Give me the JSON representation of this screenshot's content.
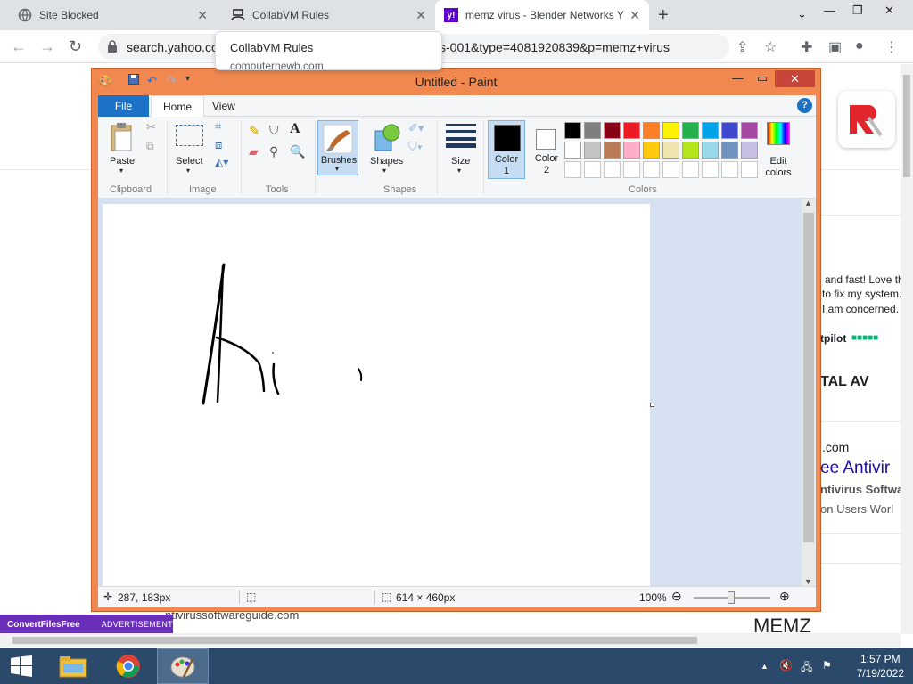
{
  "browser": {
    "tabs": [
      {
        "title": "Site Blocked"
      },
      {
        "title": "CollabVM Rules"
      },
      {
        "title": "memz virus - Blender Networks Y"
      }
    ],
    "new_tab": "+",
    "url_start": "search.yahoo.co",
    "url_end": "s-001&type=4081920839&p=memz+virus",
    "tooltip_title": "CollabVM Rules",
    "tooltip_url": "computernewb.com"
  },
  "background_page": {
    "review_lines": [
      "and fast! Love th",
      "to fix my system.",
      "I am concerned."
    ],
    "trustpilot": "tpilot",
    "brand": "TAL AV",
    "domain_suffix": ".com",
    "ad_title": "ee Antivir",
    "ad_subtitle": "ntivirus Softwa",
    "ad_line": "on Users Worl",
    "left_domain": "ntivirussoftwareguide.com",
    "bottom_right": "MEMZ",
    "ad_brand": "ConvertFilesFree",
    "ad_label": "ADVERTISEMENT"
  },
  "paint": {
    "title": "Untitled - Paint",
    "menu": {
      "file": "File",
      "home": "Home",
      "view": "View",
      "help": "?"
    },
    "groups": {
      "clipboard": "Clipboard",
      "image": "Image",
      "tools": "Tools",
      "shapes": "Shapes",
      "colors": "Colors"
    },
    "buttons": {
      "paste": "Paste",
      "select": "Select",
      "brushes": "Brushes",
      "shapes": "Shapes",
      "size": "Size",
      "color1_a": "Color",
      "color1_b": "1",
      "color2_a": "Color",
      "color2_b": "2",
      "edit_a": "Edit",
      "edit_b": "colors"
    },
    "palette_row1": [
      "#000000",
      "#7f7f7f",
      "#880015",
      "#ed1c24",
      "#ff7f27",
      "#fff200",
      "#22b14c",
      "#00a2e8",
      "#3f48cc",
      "#a349a4"
    ],
    "palette_row2": [
      "#ffffff",
      "#c3c3c3",
      "#b97a57",
      "#ffaec9",
      "#ffc90e",
      "#efe4b0",
      "#b5e61d",
      "#99d9ea",
      "#7092be",
      "#c8bfe7"
    ],
    "color1": "#000000",
    "color2": "#ffffff",
    "status": {
      "cursor_pos": "287, 183px",
      "canvas_size": "614 × 460px",
      "zoom": "100%"
    }
  },
  "taskbar": {
    "time": "1:57 PM",
    "date": "7/19/2022"
  }
}
